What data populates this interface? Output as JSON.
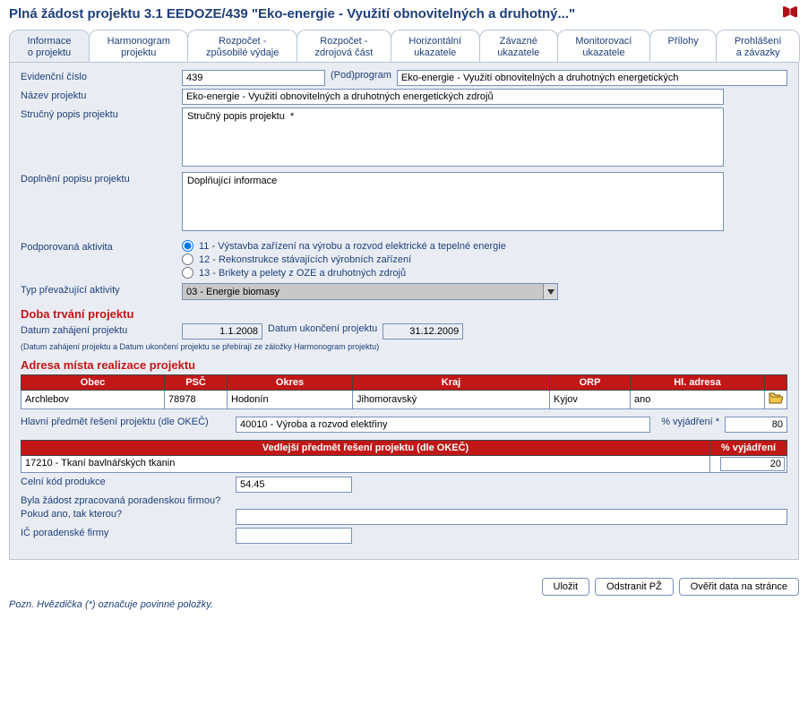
{
  "header": {
    "title": "Plná žádost projektu 3.1 EEDOZE/439 \"Eko-energie - Využití obnovitelných a druhotný...\""
  },
  "tabs": [
    {
      "l1": "Informace",
      "l2": "o projektu"
    },
    {
      "l1": "Harmonogram",
      "l2": "projektu"
    },
    {
      "l1": "Rozpočet -",
      "l2": "způsobilé výdaje"
    },
    {
      "l1": "Rozpočet -",
      "l2": "zdrojová část"
    },
    {
      "l1": "Horizontální",
      "l2": "ukazatele"
    },
    {
      "l1": "Závazné",
      "l2": "ukazatele"
    },
    {
      "l1": "Monitorovací",
      "l2": "ukazatele"
    },
    {
      "l1": "Přílohy",
      "l2": ""
    },
    {
      "l1": "Prohlášení",
      "l2": "a závazky"
    }
  ],
  "labels": {
    "evid": "Evidenční číslo",
    "podprogram": "(Pod)program",
    "nazev": "Název projektu",
    "strucny": "Stručný popis projektu",
    "doplneni": "Doplnění popisu projektu",
    "podpor": "Podporovaná aktivita",
    "typ": "Typ převažující aktivity",
    "dobatitle": "Doba trvání projektu",
    "zahajeni": "Datum zahájení projektu",
    "ukonceni": "Datum ukončení projektu",
    "dobanote": "(Datum zahájení projektu a Datum ukončení projektu se přebírají ze záložky Harmonogram projektu)",
    "adresa": "Adresa místa realizace projektu",
    "hlavni_predmet": "Hlavní předmět řešení projektu (dle OKEČ)",
    "vyjadr": "% vyjádření *",
    "vedlejsi_predmet": "Vedlejší předmět řešení projektu (dle OKEČ)",
    "vyjadr2": "% vyjádření",
    "celni": "Celní kód produkce",
    "byla": "Byla žádost zpracovaná poradenskou firmou?",
    "pokud": "Pokud ano, tak kterou?",
    "ic": "IČ poradenské firmy",
    "ulozit": "Uložit",
    "odstranit": "Odstranit PŽ",
    "overit": "Ověřit data na stránce",
    "footnote": "Pozn. Hvězdička (*) označuje povinné položky."
  },
  "values": {
    "evid": "439",
    "podprogram": "Eko-energie - Využití obnovitelných a druhotných energetických",
    "nazev": "Eko-energie - Využití obnovitelných a druhotných energetických zdrojů",
    "strucny": "Stručný popis projektu  *",
    "doplneni": "Doplňující informace",
    "r11": "11 - Výstavba zařízení na výrobu a rozvod elektrické a tepelné energie",
    "r12": "12 - Rekonstrukce stávajících výrobních zařízení",
    "r13": "13 - Brikety a pelety z OZE a druhotných zdrojů",
    "typ": "03 - Energie biomasy",
    "zahajeni": "1.1.2008",
    "ukonceni": "31.12.2009",
    "hlavni_predmet": "40010 - Výroba a rozvod elektřiny",
    "vyjadr": "80",
    "vedlejsi_row": "17210 - Tkaní bavlnářských tkanin",
    "vedlejsi_pct": "20",
    "celni": "54.45"
  },
  "tableHeaders": [
    "Obec",
    "PSČ",
    "Okres",
    "Kraj",
    "ORP",
    "Hl. adresa",
    ""
  ],
  "tableRow": {
    "obec": "Archlebov",
    "psc": "78978",
    "okres": "Hodonín",
    "kraj": "Jihomoravský",
    "orp": "Kyjov",
    "hl": "ano"
  }
}
